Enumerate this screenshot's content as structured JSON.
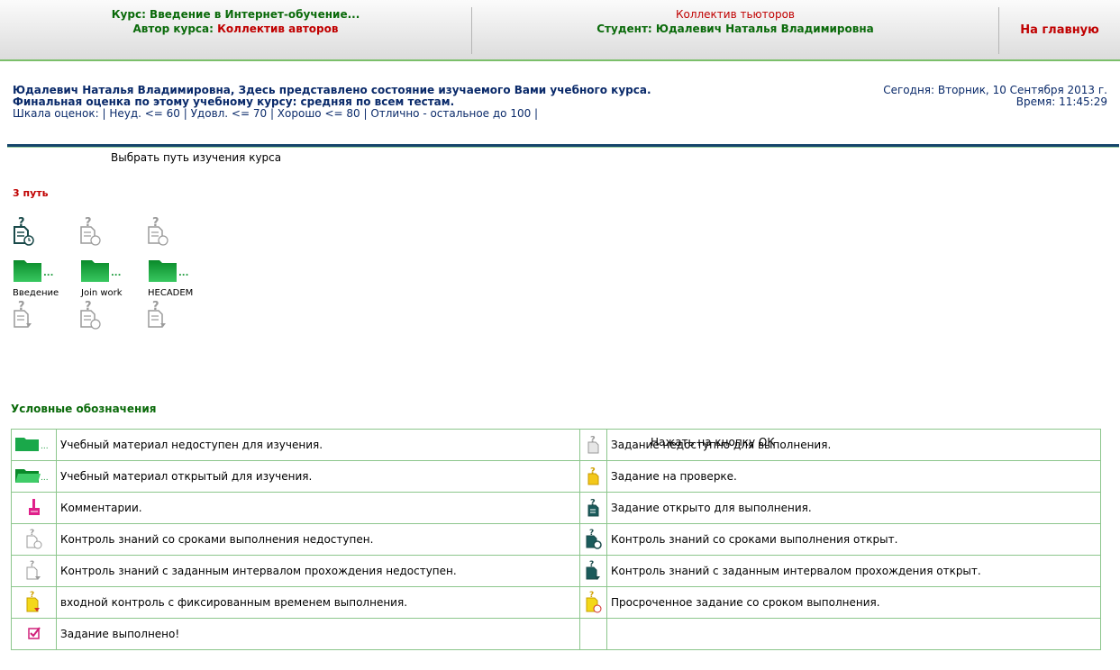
{
  "header": {
    "course_prefix": "Курс: ",
    "course_title": "Введение в Интернет-обучение...",
    "author_prefix": "Автор курса: ",
    "author_name": "Коллектив авторов",
    "tutor_label": "Коллектив тьюторов",
    "student_prefix": "Студент: ",
    "student_name": "Юдалевич Наталья Владимировна",
    "home_link": "На главную"
  },
  "info": {
    "greeting": "Юдалевич Наталья Владимировна, Здесь представлено состояние изучаемого Вами учебного курса.",
    "final_grade": "Финальная оценка по этому учебному курсу: средняя по всем тестам.",
    "scale": "Шкала оценок: | Неуд. <= 60 | Удовл. <= 70 | Хорошо <= 80 | Отлично - остальное до 100 |",
    "today": "Сегодня: Вторник, 10 Сентября 2013 г.",
    "time": "Время: 11:45:29"
  },
  "path": {
    "choose_label": "Выбрать путь изучения курса",
    "path_title": "3 путь",
    "folders": [
      "Введение",
      "Join work",
      "HECADEM"
    ],
    "folder_suffix": "..."
  },
  "legend": {
    "title": "Условные обозначения",
    "overlay_text": "Нажать на кнопку ОК",
    "rows": [
      {
        "left_icon": "folder-closed-icon",
        "left": "Учебный материал недоступен для изучения.",
        "right_icon": "task-unavailable-icon",
        "right": "Задание недоступно для выполнения."
      },
      {
        "left_icon": "folder-open-icon",
        "left": "Учебный материал открытый для изучения.",
        "right_icon": "task-review-icon",
        "right": "Задание на проверке."
      },
      {
        "left_icon": "comment-icon",
        "left": "Комментарии.",
        "right_icon": "task-open-icon",
        "right": "Задание открыто для выполнения."
      },
      {
        "left_icon": "test-deadline-unavailable-icon",
        "left": "Контроль знаний со сроками выполнения недоступен.",
        "right_icon": "test-deadline-open-icon",
        "right": "Контроль знаний со сроками выполнения открыт."
      },
      {
        "left_icon": "test-interval-unavailable-icon",
        "left": "Контроль знаний с заданным интервалом прохождения недоступен.",
        "right_icon": "test-interval-open-icon",
        "right": "Контроль знаний с заданным интервалом прохождения открыт."
      },
      {
        "left_icon": "entry-test-icon",
        "left": "входной контроль с фиксированным временем выполнения.",
        "right_icon": "overdue-task-icon",
        "right": "Просроченное задание со сроком выполнения."
      },
      {
        "left_icon": "checkbox-done-icon",
        "left": "Задание выполнено!",
        "right_icon": "",
        "right": ""
      }
    ]
  },
  "colors": {
    "header_green": "#0a6a0a",
    "accent_red": "#c00000",
    "folder_green": "#1aa84a",
    "doc_teal": "#1a5b5b",
    "doc_gray": "#9a9a9a",
    "doc_yellow": "#f3c81a",
    "comment_pink": "#e0208a"
  }
}
